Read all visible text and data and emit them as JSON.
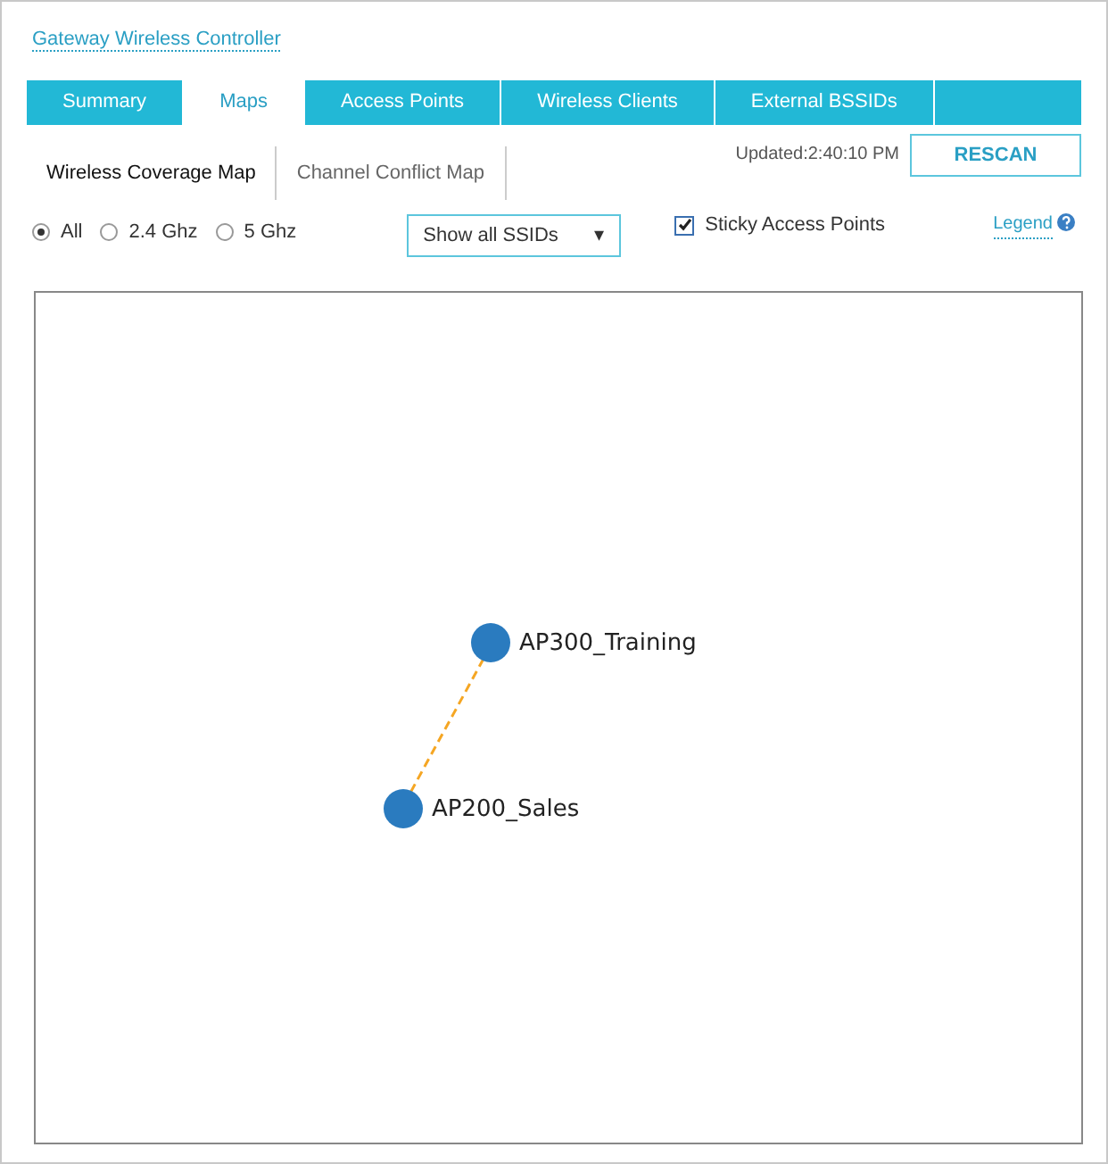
{
  "title": "Gateway Wireless Controller",
  "tabs": [
    {
      "label": "Summary",
      "selected": false
    },
    {
      "label": "Maps",
      "selected": true
    },
    {
      "label": "Access Points",
      "selected": false
    },
    {
      "label": "Wireless Clients",
      "selected": false
    },
    {
      "label": "External BSSIDs",
      "selected": false
    }
  ],
  "subtabs": [
    {
      "label": "Wireless Coverage Map",
      "selected": true
    },
    {
      "label": "Channel Conflict Map",
      "selected": false
    }
  ],
  "updated": "Updated:2:40:10 PM",
  "rescan": "RESCAN",
  "bands": [
    {
      "label": "All",
      "selected": true
    },
    {
      "label": "2.4 Ghz",
      "selected": false
    },
    {
      "label": "5 Ghz",
      "selected": false
    }
  ],
  "ssid_select": {
    "value": "Show all SSIDs",
    "caret": "▾"
  },
  "sticky": {
    "label": "Sticky Access Points",
    "checked": true
  },
  "legend": "Legend",
  "map": {
    "nodes": [
      {
        "label": "AP300_Training"
      },
      {
        "label": "AP200_Sales"
      }
    ]
  }
}
